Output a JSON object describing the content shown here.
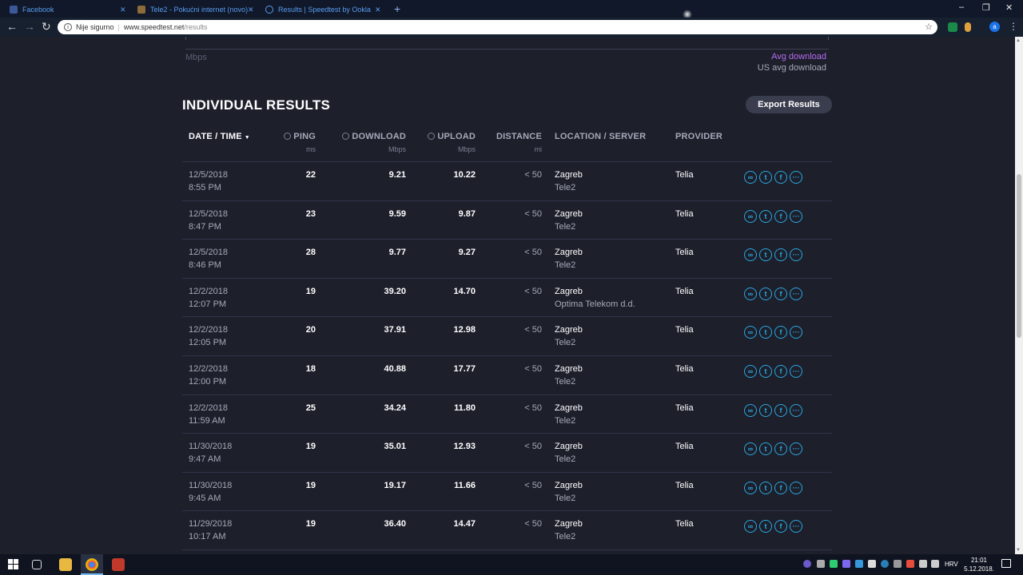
{
  "browser": {
    "tabs": [
      {
        "title": "Facebook",
        "color": "#3b5998"
      },
      {
        "title": "Tele2 - Pokućni internet (novo)",
        "color": "#8e6b3a"
      },
      {
        "title": "Results | Speedtest by Ookla",
        "color": "#2b2d42"
      }
    ],
    "new_tab": "+",
    "window_controls": {
      "minimize": "–",
      "restore": "❐",
      "close": "✕"
    },
    "nav": {
      "back": "←",
      "forward": "→",
      "reload": "↻"
    },
    "security_label": "Nije sigurno",
    "url_host": "www.speedtest.net",
    "url_path": "/results",
    "profile_initial": "a",
    "menu": "⋮",
    "tab_close": "✕"
  },
  "chart_footer": {
    "axis_unit": "Mbps",
    "legend_avg": "Avg download",
    "legend_us": "US avg download"
  },
  "section": {
    "title": "INDIVIDUAL RESULTS",
    "export_label": "Export Results"
  },
  "table": {
    "headers": {
      "date": "DATE / TIME",
      "ping": "PING",
      "download": "DOWNLOAD",
      "upload": "UPLOAD",
      "distance": "DISTANCE",
      "location": "LOCATION / SERVER",
      "provider": "PROVIDER"
    },
    "units": {
      "ping": "ms",
      "download": "Mbps",
      "upload": "Mbps",
      "distance": "mi"
    },
    "sort_caret": "▼",
    "rows": [
      {
        "date": "12/5/2018",
        "time": "8:55 PM",
        "ping": "22",
        "download": "9.21",
        "upload": "10.22",
        "distance": "< 50",
        "location": "Zagreb",
        "server": "Tele2",
        "provider": "Telia"
      },
      {
        "date": "12/5/2018",
        "time": "8:47 PM",
        "ping": "23",
        "download": "9.59",
        "upload": "9.87",
        "distance": "< 50",
        "location": "Zagreb",
        "server": "Tele2",
        "provider": "Telia"
      },
      {
        "date": "12/5/2018",
        "time": "8:46 PM",
        "ping": "28",
        "download": "9.77",
        "upload": "9.27",
        "distance": "< 50",
        "location": "Zagreb",
        "server": "Tele2",
        "provider": "Telia"
      },
      {
        "date": "12/2/2018",
        "time": "12:07 PM",
        "ping": "19",
        "download": "39.20",
        "upload": "14.70",
        "distance": "< 50",
        "location": "Zagreb",
        "server": "Optima Telekom d.d.",
        "provider": "Telia"
      },
      {
        "date": "12/2/2018",
        "time": "12:05 PM",
        "ping": "20",
        "download": "37.91",
        "upload": "12.98",
        "distance": "< 50",
        "location": "Zagreb",
        "server": "Tele2",
        "provider": "Telia"
      },
      {
        "date": "12/2/2018",
        "time": "12:00 PM",
        "ping": "18",
        "download": "40.88",
        "upload": "17.77",
        "distance": "< 50",
        "location": "Zagreb",
        "server": "Tele2",
        "provider": "Telia"
      },
      {
        "date": "12/2/2018",
        "time": "11:59 AM",
        "ping": "25",
        "download": "34.24",
        "upload": "11.80",
        "distance": "< 50",
        "location": "Zagreb",
        "server": "Tele2",
        "provider": "Telia"
      },
      {
        "date": "11/30/2018",
        "time": "9:47 AM",
        "ping": "19",
        "download": "35.01",
        "upload": "12.93",
        "distance": "< 50",
        "location": "Zagreb",
        "server": "Tele2",
        "provider": "Telia"
      },
      {
        "date": "11/30/2018",
        "time": "9:45 AM",
        "ping": "19",
        "download": "19.17",
        "upload": "11.66",
        "distance": "< 50",
        "location": "Zagreb",
        "server": "Tele2",
        "provider": "Telia"
      },
      {
        "date": "11/29/2018",
        "time": "10:17 AM",
        "ping": "19",
        "download": "36.40",
        "upload": "14.47",
        "distance": "< 50",
        "location": "Zagreb",
        "server": "Tele2",
        "provider": "Telia"
      }
    ],
    "share_icons": {
      "link": "∞",
      "twitter": "t",
      "facebook": "f",
      "more": "···"
    }
  },
  "taskbar": {
    "language": "HRV",
    "time": "21:01",
    "date": "5.12.2018."
  },
  "colors": {
    "accent": "#2aa8e0",
    "avg_download": "#b56cf0",
    "background": "#1d1f2b"
  }
}
